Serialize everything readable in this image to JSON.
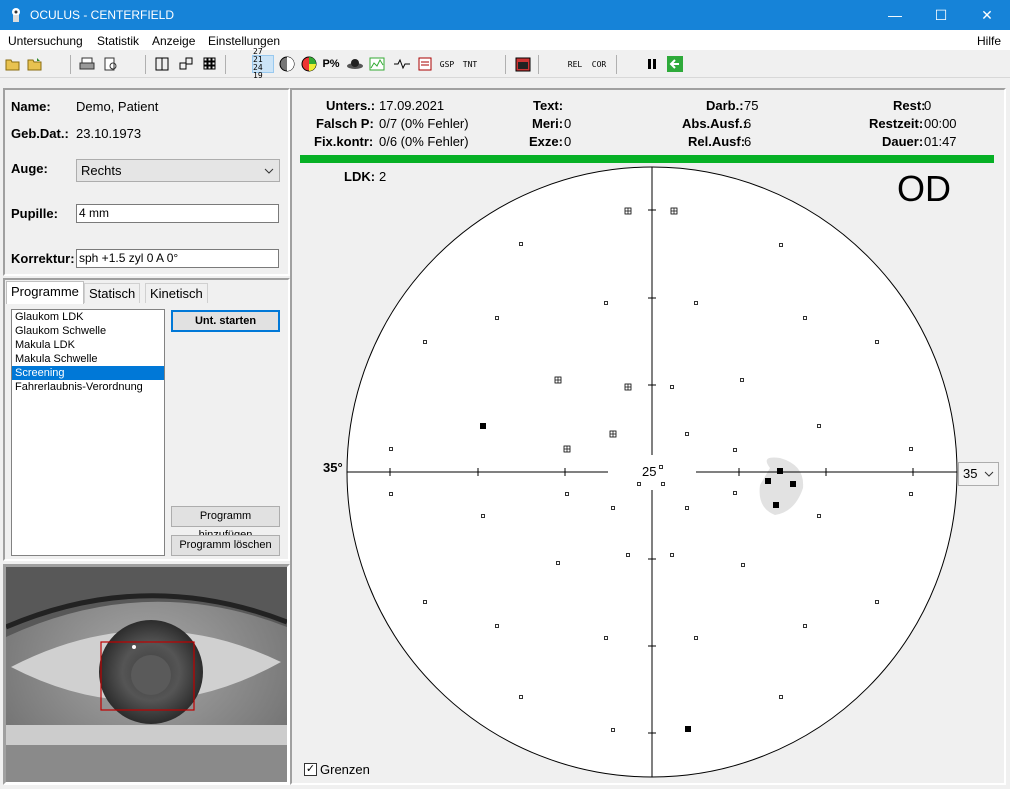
{
  "window": {
    "title": "OCULUS  -  CENTERFIELD",
    "minimize": "—",
    "maximize": "☐",
    "close": "✕"
  },
  "menu": {
    "items": [
      "Untersuchung",
      "Statistik",
      "Anzeige",
      "Einstellungen"
    ],
    "help": "Hilfe"
  },
  "toolbar": {
    "date_text_top": "27 21",
    "date_text_bottom": "24 19",
    "gsp": "GSP",
    "tnt": "TNT",
    "rel": "REL",
    "cor": "COR"
  },
  "patient": {
    "name_label": "Name:",
    "name": "Demo, Patient",
    "dob_label": "Geb.Dat.:",
    "dob": "23.10.1973",
    "eye_label": "Auge:",
    "eye": "Rechts",
    "pupil_label": "Pupille:",
    "pupil": "4 mm",
    "correction_label": "Korrektur:",
    "correction": "sph +1.5  zyl 0  A 0°"
  },
  "tabs": [
    "Programme",
    "Statisch",
    "Kinetisch"
  ],
  "programs": {
    "items": [
      "Glaukom LDK",
      "Glaukom Schwelle",
      "Makula LDK",
      "Makula Schwelle",
      "Screening",
      "Fahrerlaubnis-Verordnung"
    ],
    "selected": "Screening",
    "start_button": "Unt. starten",
    "add_button": "Programm hinzufügen",
    "delete_button": "Programm löschen"
  },
  "exam": {
    "unters_label": "Unters.:",
    "unters": "17.09.2021",
    "falsch_label": "Falsch P:",
    "falsch": "0/7 (0% Fehler)",
    "fix_label": "Fix.kontr:",
    "fix": "0/6 (0% Fehler)",
    "text_label": "Text:",
    "meri_label": "Meri:",
    "meri": "0",
    "exze_label": "Exze:",
    "exze": "0",
    "darb_label": "Darb.:",
    "darb": "75",
    "abs_label": "Abs.Ausf.:",
    "abs": "6",
    "rel_label": "Rel.Ausf:",
    "rel": "6",
    "rest_label": "Rest:",
    "rest": "0",
    "restzeit_label": "Restzeit:",
    "restzeit": "00:00",
    "dauer_label": "Dauer:",
    "dauer": "01:47",
    "progress": 1.0,
    "progress_color": "#06b025"
  },
  "field": {
    "ldk_label": "LDK:",
    "ldk": "2",
    "eye_label": "OD",
    "scale_label": "35°",
    "center_value": "25",
    "range_select": "35",
    "border_checkbox_label": "Grenzen",
    "border_checked": true
  }
}
